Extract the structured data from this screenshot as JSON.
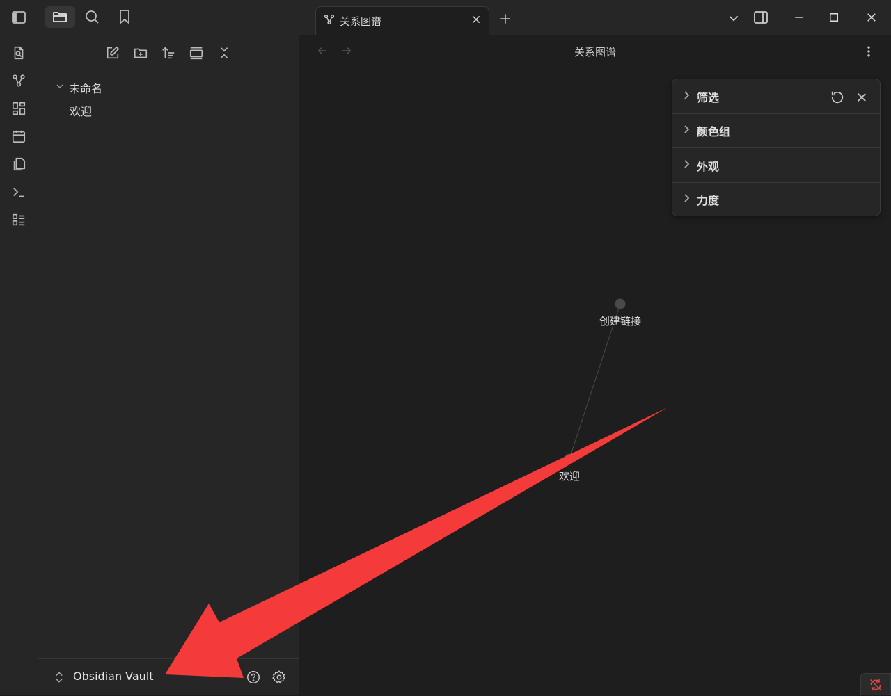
{
  "toolbar": {
    "new_note": "新建笔记",
    "new_folder": "新建文件夹",
    "sort": "排序",
    "auto_reveal": "自动定位",
    "collapse_all": "全部折叠"
  },
  "tree": {
    "folder": "未命名",
    "files": [
      "欢迎"
    ]
  },
  "tab": {
    "title": "关系图谱"
  },
  "view": {
    "title": "关系图谱"
  },
  "graph": {
    "nodes": [
      {
        "label": "创建链接"
      },
      {
        "label": "欢迎"
      }
    ],
    "edges": [
      [
        "创建链接",
        "欢迎"
      ]
    ]
  },
  "graph_panel": {
    "sections": [
      "筛选",
      "颜色组",
      "外观",
      "力度"
    ]
  },
  "vault": {
    "name": "Obsidian Vault"
  },
  "colors": {
    "background": "#1e1e1e",
    "sidebar": "#262626",
    "annotation_arrow": "#f53a3a",
    "sync_icon": "#e04848"
  }
}
